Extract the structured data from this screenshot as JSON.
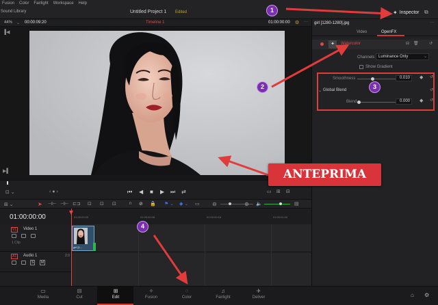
{
  "menu": [
    "Fusion",
    "Color",
    "Fairlight",
    "Workspace",
    "Help"
  ],
  "titlebar": {
    "sound_library": "Sound Library",
    "project_title": "Untitled Project 1",
    "edited": "Edited",
    "inspector": "Inspector"
  },
  "viewer": {
    "zoom": "44%",
    "timecode_left": "00:00:09:20",
    "timeline_name": "Timeline 1",
    "timecode_right": "01:00:00:00"
  },
  "inspector": {
    "filename": "girl [1280-1280].jpg",
    "tabs": [
      "Video",
      "OpenFX"
    ],
    "effect_name": "Watercolor",
    "channels_label": "Channels",
    "channels_value": "Luminance Only",
    "show_gradient": "Show Gradient",
    "smoothness_label": "Smoothness",
    "smoothness_value": "0.010",
    "smoothness_level": 0.1,
    "global_blend": "Global Blend",
    "blend_label": "Blend",
    "blend_value": "0.000",
    "blend_level": 0.0
  },
  "timeline": {
    "timecode": "01:00:00:00",
    "ruler": [
      "01:00:00:00",
      "01:00:00:08",
      "01:00:00:16",
      "01:00:01:00"
    ],
    "video_track": {
      "id": "V1",
      "name": "Video 1",
      "clips": "1 Clip"
    },
    "audio_track": {
      "id": "A1",
      "name": "Audio 1",
      "level": "2.0"
    },
    "clip_label": "girl [1..."
  },
  "nav": [
    "Media",
    "Cut",
    "Edit",
    "Fusion",
    "Color",
    "Fairlight",
    "Deliver"
  ],
  "annotations": {
    "b1": "1",
    "b2": "2",
    "b3": "3",
    "b4": "4",
    "anteprima": "ANTEPRIMA"
  },
  "colors": {
    "accent_red": "#e03c3c",
    "badge_purple": "#7b2fb0",
    "edited": "#c9a13a"
  }
}
